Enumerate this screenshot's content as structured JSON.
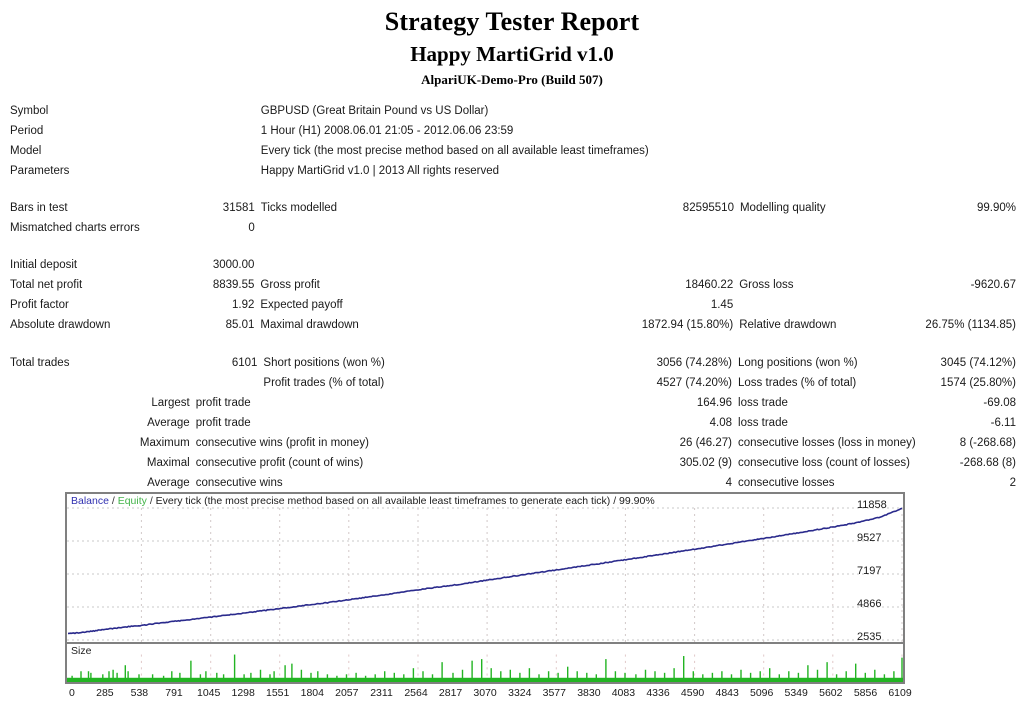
{
  "header": {
    "title": "Strategy Tester Report",
    "ea_name": "Happy MartiGrid v1.0",
    "broker": "AlpariUK-Demo-Pro (Build 507)"
  },
  "info": {
    "symbol_label": "Symbol",
    "symbol_value": "GBPUSD (Great Britain Pound vs US Dollar)",
    "period_label": "Period",
    "period_value": "1 Hour (H1) 2008.06.01 21:05 - 2012.06.06 23:59",
    "model_label": "Model",
    "model_value": "Every tick (the most precise method based on all available least timeframes)",
    "parameters_label": "Parameters",
    "parameters_value": "Happy MartiGrid v1.0 | 2013 All rights reserved"
  },
  "modelling": {
    "bars_label": "Bars in test",
    "bars_value": "31581",
    "ticks_label": "Ticks modelled",
    "ticks_value": "82595510",
    "quality_label": "Modelling quality",
    "quality_value": "99.90%",
    "mismatch_label": "Mismatched charts errors",
    "mismatch_value": "0"
  },
  "profit": {
    "deposit_label": "Initial deposit",
    "deposit_value": "3000.00",
    "net_profit_label": "Total net profit",
    "net_profit_value": "8839.55",
    "gross_profit_label": "Gross profit",
    "gross_profit_value": "18460.22",
    "gross_loss_label": "Gross loss",
    "gross_loss_value": "-9620.67",
    "profit_factor_label": "Profit factor",
    "profit_factor_value": "1.92",
    "expected_payoff_label": "Expected payoff",
    "expected_payoff_value": "1.45",
    "abs_dd_label": "Absolute drawdown",
    "abs_dd_value": "85.01",
    "max_dd_label": "Maximal drawdown",
    "max_dd_value": "1872.94 (15.80%)",
    "rel_dd_label": "Relative drawdown",
    "rel_dd_value": "26.75% (1134.85)"
  },
  "trades": {
    "total_label": "Total trades",
    "total_value": "6101",
    "short_label": "Short positions (won %)",
    "short_value": "3056 (74.28%)",
    "long_label": "Long positions (won %)",
    "long_value": "3045 (74.12%)",
    "profit_trades_label": "Profit trades (% of total)",
    "profit_trades_value": "4527 (74.20%)",
    "loss_trades_label": "Loss trades (% of total)",
    "loss_trades_value": "1574 (25.80%)",
    "largest_label": "Largest",
    "largest_profit_label": "profit trade",
    "largest_profit_value": "164.96",
    "largest_loss_label": "loss trade",
    "largest_loss_value": "-69.08",
    "average_label": "Average",
    "average_profit_label": "profit trade",
    "average_profit_value": "4.08",
    "average_loss_label": "loss trade",
    "average_loss_value": "-6.11",
    "maximum_label": "Maximum",
    "max_cons_wins_label": "consecutive wins (profit in money)",
    "max_cons_wins_value": "26 (46.27)",
    "max_cons_losses_label": "consecutive losses (loss in money)",
    "max_cons_losses_value": "8 (-268.68)",
    "maximal_label": "Maximal",
    "maximal_cons_profit_label": "consecutive profit (count of wins)",
    "maximal_cons_profit_value": "305.02 (9)",
    "maximal_cons_loss_label": "consecutive loss (count of losses)",
    "maximal_cons_loss_value": "-268.68 (8)",
    "average2_label": "Average",
    "avg_cons_wins_label": "consecutive wins",
    "avg_cons_wins_value": "4",
    "avg_cons_losses_label": "consecutive losses",
    "avg_cons_losses_value": "2"
  },
  "chart": {
    "legend_balance": "Balance",
    "legend_equity": "Equity",
    "legend_sep1": " / ",
    "legend_sep2": " / ",
    "legend_rest": "Every tick (the most precise method based on all available least timeframes to generate each tick) / 99.90%",
    "size_label": "Size",
    "balance_color": "#2a2a8c",
    "equity_color": "#44b44a",
    "size_color": "#22b422"
  },
  "chart_data": {
    "type": "line",
    "title": "Balance / Equity",
    "xlabel": "",
    "ylabel": "",
    "grid": true,
    "legend_position": "top-left",
    "ylim": [
      2535,
      11858
    ],
    "yticks": [
      2535,
      4866,
      7197,
      9527,
      11858
    ],
    "xlim": [
      0,
      6109
    ],
    "xticks": [
      0,
      285,
      538,
      791,
      1045,
      1298,
      1551,
      1804,
      2057,
      2311,
      2564,
      2817,
      3070,
      3324,
      3577,
      3830,
      4083,
      4336,
      4590,
      4843,
      5096,
      5349,
      5602,
      5856,
      6109
    ],
    "series": [
      {
        "name": "Balance",
        "color": "#2a2a8c",
        "x": [
          0,
          120,
          250,
          400,
          550,
          700,
          850,
          1000,
          1150,
          1300,
          1450,
          1600,
          1750,
          1900,
          2050,
          2200,
          2350,
          2500,
          2650,
          2800,
          2950,
          3100,
          3250,
          3400,
          3550,
          3700,
          3850,
          4000,
          4150,
          4300,
          4450,
          4600,
          4750,
          4900,
          5050,
          5200,
          5350,
          5500,
          5650,
          5800,
          5950,
          6109
        ],
        "values": [
          3000,
          3120,
          3280,
          3460,
          3610,
          3790,
          3960,
          4130,
          4300,
          4480,
          4660,
          4840,
          5030,
          5200,
          5400,
          5600,
          5810,
          6020,
          6230,
          6400,
          6620,
          6830,
          7050,
          7260,
          7470,
          7690,
          7900,
          8110,
          8330,
          8550,
          8770,
          8990,
          9220,
          9440,
          9670,
          9900,
          10140,
          10380,
          10620,
          10900,
          11250,
          11839
        ]
      },
      {
        "name": "Equity",
        "color": "#44b44a",
        "x": [
          0,
          6109
        ],
        "values": [
          3000,
          11839
        ]
      }
    ],
    "subchart": {
      "type": "bar",
      "name": "Size",
      "color": "#22b422",
      "ylabel": "Size",
      "x": [
        30,
        95,
        150,
        168,
        255,
        300,
        330,
        360,
        420,
        440,
        520,
        620,
        700,
        760,
        820,
        900,
        970,
        1010,
        1090,
        1140,
        1220,
        1290,
        1340,
        1410,
        1480,
        1510,
        1590,
        1640,
        1710,
        1780,
        1830,
        1900,
        1970,
        2040,
        2110,
        2180,
        2250,
        2320,
        2390,
        2460,
        2530,
        2600,
        2670,
        2740,
        2820,
        2890,
        2960,
        3030,
        3100,
        3170,
        3240,
        3310,
        3380,
        3450,
        3520,
        3590,
        3660,
        3730,
        3800,
        3870,
        3940,
        4010,
        4080,
        4160,
        4230,
        4300,
        4370,
        4440,
        4510,
        4580,
        4650,
        4720,
        4790,
        4860,
        4930,
        5000,
        5070,
        5140,
        5210,
        5280,
        5350,
        5420,
        5490,
        5560,
        5630,
        5700,
        5770,
        5840,
        5910,
        5980,
        6050,
        6109
      ],
      "values": [
        2,
        5,
        5,
        4,
        3,
        5,
        6,
        4,
        9,
        5,
        3,
        3,
        2,
        5,
        4,
        12,
        3,
        5,
        4,
        3,
        16,
        3,
        4,
        6,
        3,
        5,
        9,
        10,
        6,
        4,
        5,
        3,
        2,
        3,
        4,
        2,
        3,
        5,
        4,
        3,
        7,
        5,
        3,
        11,
        4,
        6,
        12,
        13,
        7,
        5,
        6,
        4,
        7,
        3,
        5,
        4,
        8,
        5,
        4,
        3,
        13,
        5,
        4,
        3,
        6,
        5,
        4,
        7,
        15,
        5,
        3,
        4,
        5,
        3,
        6,
        4,
        5,
        7,
        3,
        5,
        4,
        9,
        6,
        11,
        3,
        5,
        10,
        4,
        6,
        3,
        5,
        14
      ]
    }
  }
}
